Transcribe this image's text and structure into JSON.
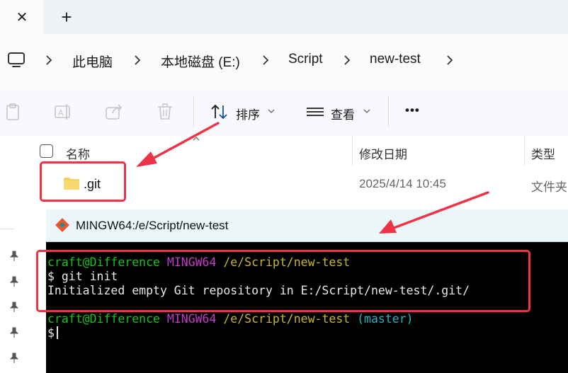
{
  "tabs": {
    "close_symbol": "✕",
    "new_symbol": "+"
  },
  "breadcrumb": {
    "items": [
      "此电脑",
      "本地磁盘 (E:)",
      "Script",
      "new-test"
    ]
  },
  "toolbar": {
    "sort_label": "排序",
    "view_label": "查看",
    "more_symbol": "•••"
  },
  "columns": {
    "name": "名称",
    "modified": "修改日期",
    "type": "类型"
  },
  "files": [
    {
      "name": ".git",
      "modified": "2025/4/14 10:45",
      "type": "文件夹"
    }
  ],
  "terminal": {
    "title": "MINGW64:/e/Script/new-test",
    "lines": [
      {
        "user": "craft@Difference",
        "env": "MINGW64",
        "path": "/e/Script/new-test"
      },
      {
        "text": "$ git init"
      },
      {
        "text": "Initialized empty Git repository in E:/Script/new-test/.git/"
      },
      {
        "user": "craft@Difference",
        "env": "MINGW64",
        "path": "/e/Script/new-test",
        "branch": "(master)"
      },
      {
        "text": "$"
      }
    ]
  },
  "colors": {
    "annotation_red": "#ee3347",
    "prompt_green": "#13c41a",
    "prompt_magenta": "#c23bc9",
    "prompt_yellow": "#c8b530",
    "branch_cyan": "#27b4c2"
  }
}
